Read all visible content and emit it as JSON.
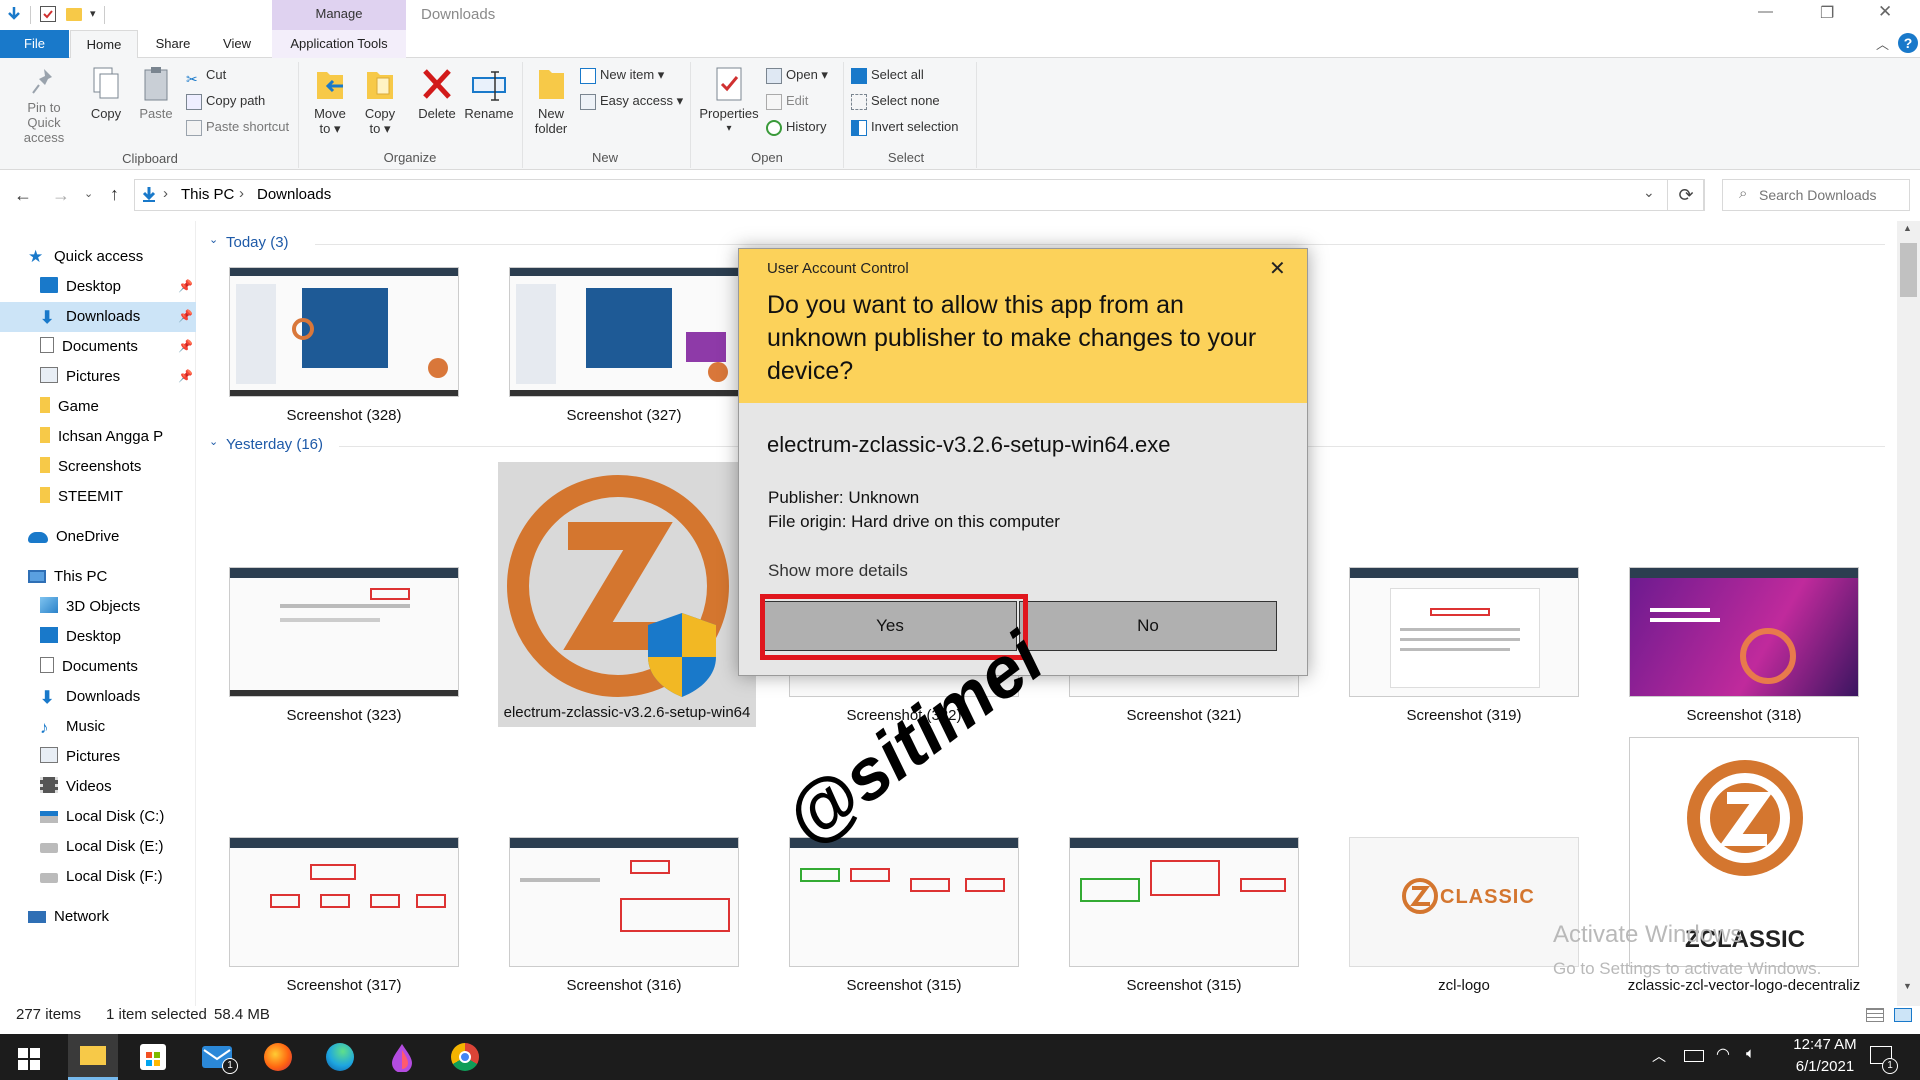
{
  "window": {
    "title": "Downloads",
    "context_tab": "Manage",
    "controls": {
      "minimize": "—",
      "restore": "❐",
      "close": "✕"
    }
  },
  "tabs": [
    "File",
    "Home",
    "Share",
    "View",
    "Application Tools"
  ],
  "ribbon": {
    "clipboard": {
      "label": "Clipboard",
      "pin": "Pin to Quick access",
      "copy": "Copy",
      "paste": "Paste",
      "cut": "Cut",
      "copy_path": "Copy path",
      "paste_shortcut": "Paste shortcut"
    },
    "organize": {
      "label": "Organize",
      "move_to": "Move to ▾",
      "copy_to": "Copy to ▾",
      "delete": "Delete",
      "rename": "Rename"
    },
    "new": {
      "label": "New",
      "new_folder": "New folder",
      "new_item": "New item ▾",
      "easy_access": "Easy access ▾"
    },
    "open": {
      "label": "Open",
      "properties": "Properties",
      "open": "Open ▾",
      "edit": "Edit",
      "history": "History"
    },
    "select": {
      "label": "Select",
      "select_all": "Select all",
      "select_none": "Select none",
      "invert": "Invert selection"
    }
  },
  "address": {
    "crumbs": [
      "This PC",
      "Downloads"
    ],
    "search_placeholder": "Search Downloads"
  },
  "sidebar": {
    "items": [
      {
        "label": "Quick access"
      },
      {
        "label": "Desktop"
      },
      {
        "label": "Downloads"
      },
      {
        "label": "Documents"
      },
      {
        "label": "Pictures"
      },
      {
        "label": "Game"
      },
      {
        "label": "Ichsan Angga P"
      },
      {
        "label": "Screenshots"
      },
      {
        "label": "STEEMIT"
      },
      {
        "label": "OneDrive"
      },
      {
        "label": "This PC"
      },
      {
        "label": "3D Objects"
      },
      {
        "label": "Desktop"
      },
      {
        "label": "Documents"
      },
      {
        "label": "Downloads"
      },
      {
        "label": "Music"
      },
      {
        "label": "Pictures"
      },
      {
        "label": "Videos"
      },
      {
        "label": "Local Disk (C:)"
      },
      {
        "label": "Local Disk (E:)"
      },
      {
        "label": "Local Disk (F:)"
      },
      {
        "label": "Network"
      }
    ]
  },
  "groups": {
    "today": "Today (3)",
    "yesterday": "Yesterday (16)"
  },
  "files": {
    "today": [
      "Screenshot (328)",
      "Screenshot (327)"
    ],
    "row2": [
      "Screenshot (323)",
      "electrum-zclassic-v3.2.6-setup-win64",
      "Screenshot (322)",
      "Screenshot (321)",
      "Screenshot (319)",
      "Screenshot (318)"
    ],
    "row3": [
      "Screenshot (317)",
      "Screenshot (316)",
      "Screenshot (315)",
      "Screenshot (315)",
      "zcl-logo",
      "zclassic-zcl-vector-logo-decentraliz"
    ]
  },
  "logo_text": {
    "classic": "CLASSIC",
    "zclassic": "ZCLASSIC"
  },
  "status": {
    "count": "277 items",
    "selected": "1 item selected",
    "size": "58.4 MB"
  },
  "uac": {
    "title": "User Account Control",
    "question": "Do you want to allow this app from an unknown publisher to make changes to your device?",
    "app": "electrum-zclassic-v3.2.6-setup-win64.exe",
    "publisher": "Publisher: Unknown",
    "origin": "File origin: Hard drive on this computer",
    "more": "Show more details",
    "yes": "Yes",
    "no": "No"
  },
  "watermark": {
    "activate": "Activate Windows",
    "goto": "Go to Settings to activate Windows.",
    "handle": "@sitimei"
  },
  "taskbar": {
    "time": "12:47 AM",
    "date": "6/1/2021",
    "mail_badge": "1",
    "notif_badge": "1"
  },
  "colors": {
    "accent": "#1979ca",
    "uac_header": "#fcd25a",
    "highlight_box": "#e0161d",
    "folder": "#f7c948"
  }
}
